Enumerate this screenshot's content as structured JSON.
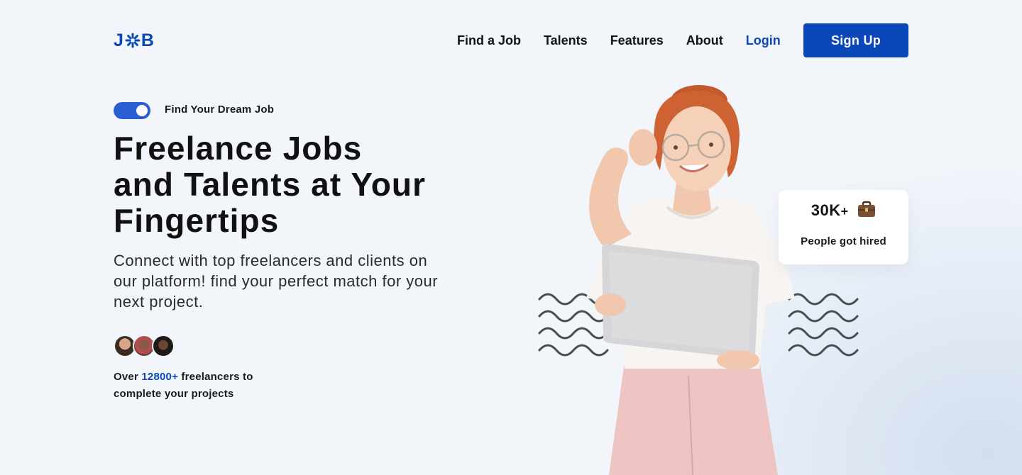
{
  "header": {
    "logo": {
      "left": "J",
      "right": "B"
    },
    "nav": [
      "Find a Job",
      "Talents",
      "Features",
      "About"
    ],
    "login": "Login",
    "signup": "Sign Up"
  },
  "hero": {
    "eyebrow": "Find Your Dream Job",
    "headline": [
      "Freelance Jobs",
      "and Talents at Your",
      "Fingertips"
    ],
    "subhead": "Connect with top freelancers and clients on our platform! find your perfect match for your next project.",
    "stat_prefix": "Over",
    "stat_count": "12800+",
    "stat_suffix": "freelancers to complete your projects"
  },
  "stat_card": {
    "value": "30K",
    "plus": "+",
    "label": "People got hired",
    "icon": "briefcase-icon"
  },
  "colors": {
    "brand": "#0a47b8",
    "toggle": "#2a5fd4",
    "background": "#f2f6fb"
  }
}
